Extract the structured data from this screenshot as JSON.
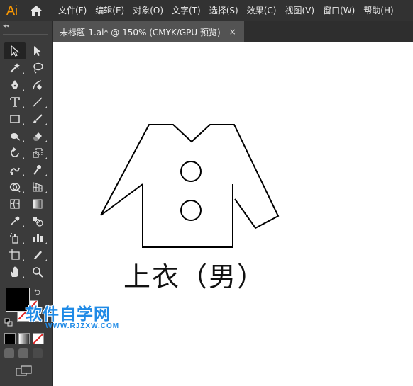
{
  "app": {
    "logo": "Ai",
    "brand_color": "#ff9a00"
  },
  "menu": [
    "文件(F)",
    "编辑(E)",
    "对象(O)",
    "文字(T)",
    "选择(S)",
    "效果(C)",
    "视图(V)",
    "窗口(W)",
    "帮助(H)"
  ],
  "toolbar": {
    "collapse_label": "◂◂",
    "tools": [
      "selection-tool",
      "direct-selection-tool",
      "magic-wand-tool",
      "lasso-tool",
      "pen-tool",
      "curvature-tool",
      "type-tool",
      "line-segment-tool",
      "rectangle-tool",
      "paintbrush-tool",
      "shaper-tool",
      "eraser-tool",
      "rotate-tool",
      "scale-tool",
      "warp-tool",
      "puppet-warp-tool",
      "shape-builder-tool",
      "perspective-grid-tool",
      "mesh-tool",
      "gradient-tool",
      "eyedropper-tool",
      "blend-tool",
      "symbol-sprayer-tool",
      "column-graph-tool",
      "artboard-tool",
      "slice-tool",
      "hand-tool",
      "zoom-tool"
    ],
    "fill_color": "#000000",
    "stroke_color": "#ffffff"
  },
  "tab": {
    "title": "未标题-1.ai* @ 150% (CMYK/GPU 预览)",
    "close": "×"
  },
  "canvas": {
    "caption": "上衣（男）"
  },
  "watermark": {
    "title": "软件自学网",
    "url": "WWW.RJZXW.COM",
    "color": "#1f8ae6"
  }
}
